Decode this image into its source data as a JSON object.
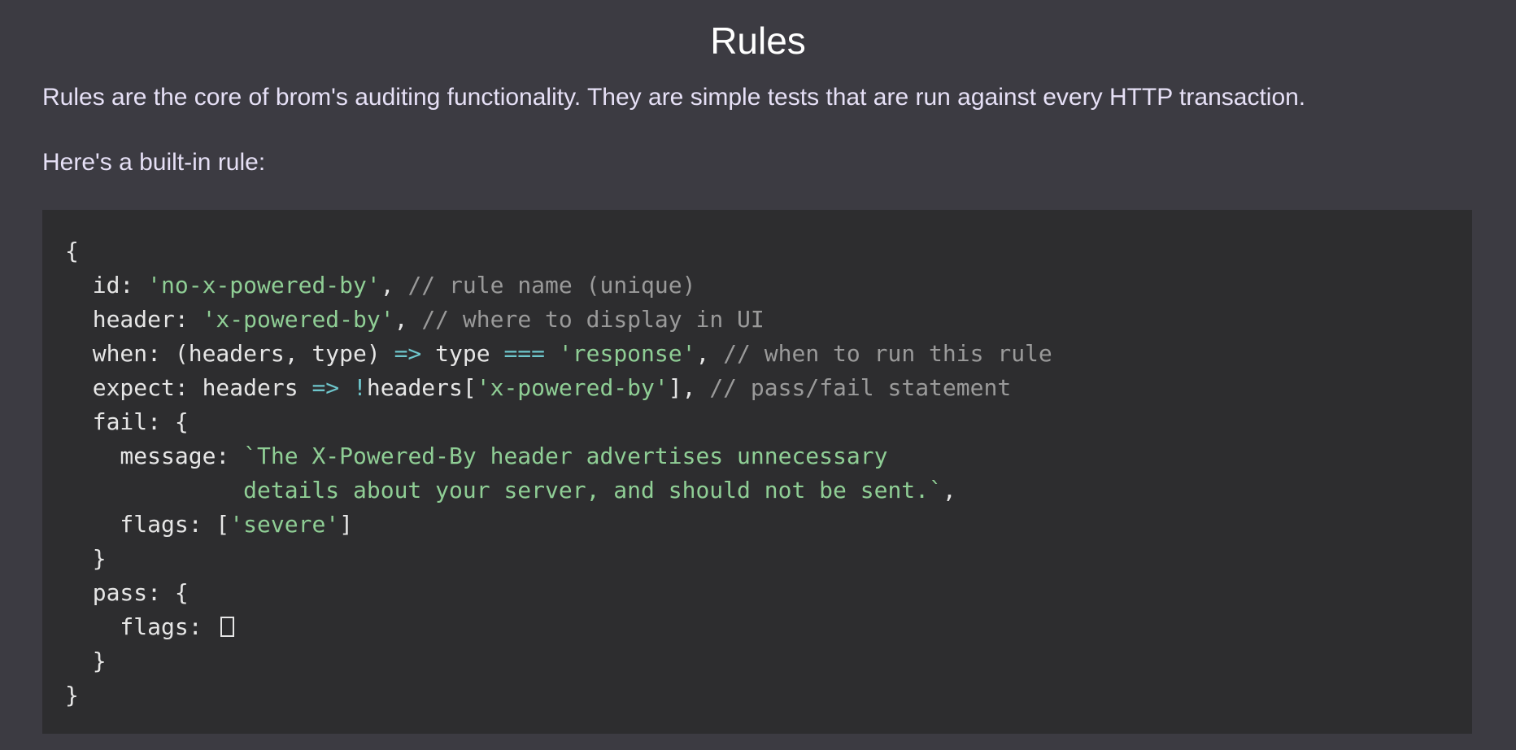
{
  "page": {
    "title": "Rules",
    "intro": "Rules are the core of brom's auditing functionality. They are simple tests that are run against every HTTP transaction.",
    "lead": "Here's a built-in rule:"
  },
  "code": {
    "language": "javascript",
    "colors": {
      "background": "#2d2d2f",
      "plain": "#e6e6e6",
      "string": "#8fce95",
      "comment": "#9a9a9a",
      "operator": "#6ec6cc"
    },
    "lines": [
      [
        {
          "t": "p",
          "v": "{"
        }
      ],
      [
        {
          "t": "p",
          "v": "  id: "
        },
        {
          "t": "s",
          "v": "'no-x-powered-by'"
        },
        {
          "t": "p",
          "v": ", "
        },
        {
          "t": "c",
          "v": "// rule name (unique)"
        }
      ],
      [
        {
          "t": "p",
          "v": "  header: "
        },
        {
          "t": "s",
          "v": "'x-powered-by'"
        },
        {
          "t": "p",
          "v": ", "
        },
        {
          "t": "c",
          "v": "// where to display in UI"
        }
      ],
      [
        {
          "t": "p",
          "v": "  when: (headers, type) "
        },
        {
          "t": "o",
          "v": "=>"
        },
        {
          "t": "p",
          "v": " type "
        },
        {
          "t": "o",
          "v": "==="
        },
        {
          "t": "p",
          "v": " "
        },
        {
          "t": "s",
          "v": "'response'"
        },
        {
          "t": "p",
          "v": ", "
        },
        {
          "t": "c",
          "v": "// when to run this rule"
        }
      ],
      [
        {
          "t": "p",
          "v": "  expect: headers "
        },
        {
          "t": "o",
          "v": "=>"
        },
        {
          "t": "p",
          "v": " "
        },
        {
          "t": "o",
          "v": "!"
        },
        {
          "t": "p",
          "v": "headers["
        },
        {
          "t": "s",
          "v": "'x-powered-by'"
        },
        {
          "t": "p",
          "v": "], "
        },
        {
          "t": "c",
          "v": "// pass/fail statement"
        }
      ],
      [
        {
          "t": "p",
          "v": "  fail: {"
        }
      ],
      [
        {
          "t": "p",
          "v": "    message: "
        },
        {
          "t": "s",
          "v": "`The X-Powered-By header advertises unnecessary"
        }
      ],
      [
        {
          "t": "s",
          "v": "             details about your server, and should not be sent.`"
        },
        {
          "t": "p",
          "v": ","
        }
      ],
      [
        {
          "t": "p",
          "v": "    flags: ["
        },
        {
          "t": "s",
          "v": "'severe'"
        },
        {
          "t": "p",
          "v": "]"
        }
      ],
      [
        {
          "t": "p",
          "v": "  }"
        }
      ],
      [
        {
          "t": "p",
          "v": "  pass: {"
        }
      ],
      [
        {
          "t": "p",
          "v": "    flags: "
        },
        {
          "t": "e",
          "v": ""
        }
      ],
      [
        {
          "t": "p",
          "v": "  }"
        }
      ],
      [
        {
          "t": "p",
          "v": "}"
        }
      ]
    ]
  }
}
